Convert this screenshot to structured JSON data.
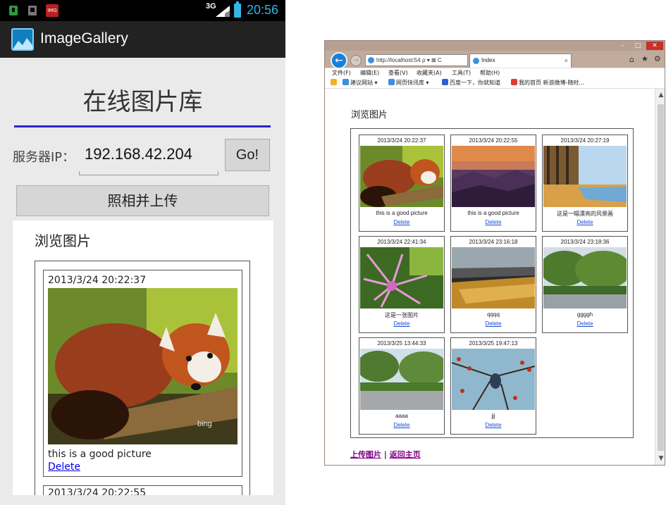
{
  "phone": {
    "status_bar": {
      "network": "3G",
      "time": "20:56",
      "app_icon_text": "IMG"
    },
    "action_bar": {
      "title": "ImageGallery"
    },
    "title": "在线图片库",
    "server_ip_label": "服务器IP：",
    "server_ip_value": "192.168.42.204",
    "go_button": "Go!",
    "upload_button": "照相并上传",
    "web": {
      "browse_title": "浏览图片",
      "items": [
        {
          "date": "2013/3/24 20:22:37",
          "caption": "this is a good picture",
          "delete": "Delete"
        },
        {
          "date": "2013/3/24 20:22:55"
        }
      ]
    }
  },
  "browser": {
    "window_buttons": {
      "minimize": "–",
      "maximize": "□",
      "close": "✕"
    },
    "address": "http://localhost:54",
    "address_icons": "ρ ▾ ⊠ C",
    "tab_title": "Index",
    "menu": [
      "文件(F)",
      "编辑(E)",
      "查看(V)",
      "收藏夹(A)",
      "工具(T)",
      "帮助(H)"
    ],
    "favorites": [
      "建议网站 ▾",
      "网页快讯库 ▾",
      "百度一下，你就知道",
      "我的首页 新浪微博-随时..."
    ],
    "page": {
      "browse_title": "浏览图片",
      "items": [
        {
          "date": "2013/3/24 20:22:37",
          "caption": "this is a good picture",
          "delete": "Delete",
          "image": "red-panda"
        },
        {
          "date": "2013/3/24 20:22:55",
          "caption": "this is a good picture",
          "delete": "Delete",
          "image": "sunset-mountains"
        },
        {
          "date": "2013/3/24 20:27:19",
          "caption": "这是一幅漂亮的风景画",
          "delete": "Delete",
          "image": "autumn-lake"
        },
        {
          "date": "2013/3/24 22:41:34",
          "caption": "这是一张图片",
          "delete": "Delete",
          "image": "pink-flower"
        },
        {
          "date": "2013/3/24 23:16:18",
          "caption": "qqqq",
          "delete": "Delete",
          "image": "desk-closeup"
        },
        {
          "date": "2013/3/24 23:18:36",
          "caption": "ggggh",
          "delete": "Delete",
          "image": "park-trees"
        },
        {
          "date": "2013/3/25 13:44:33",
          "caption": "aaaa",
          "delete": "Delete",
          "image": "park-road"
        },
        {
          "date": "2013/3/25 19:47:13",
          "caption": "jjj",
          "delete": "Delete",
          "image": "bird-branch"
        }
      ],
      "links": {
        "upload": "上传图片",
        "separator": "|",
        "home": "返回主页"
      }
    }
  },
  "colors": {
    "android_blue": "#33b5e5",
    "divider_blue": "#2727d0",
    "link_blue": "#1a4bd8",
    "visited_purple": "#800080"
  }
}
